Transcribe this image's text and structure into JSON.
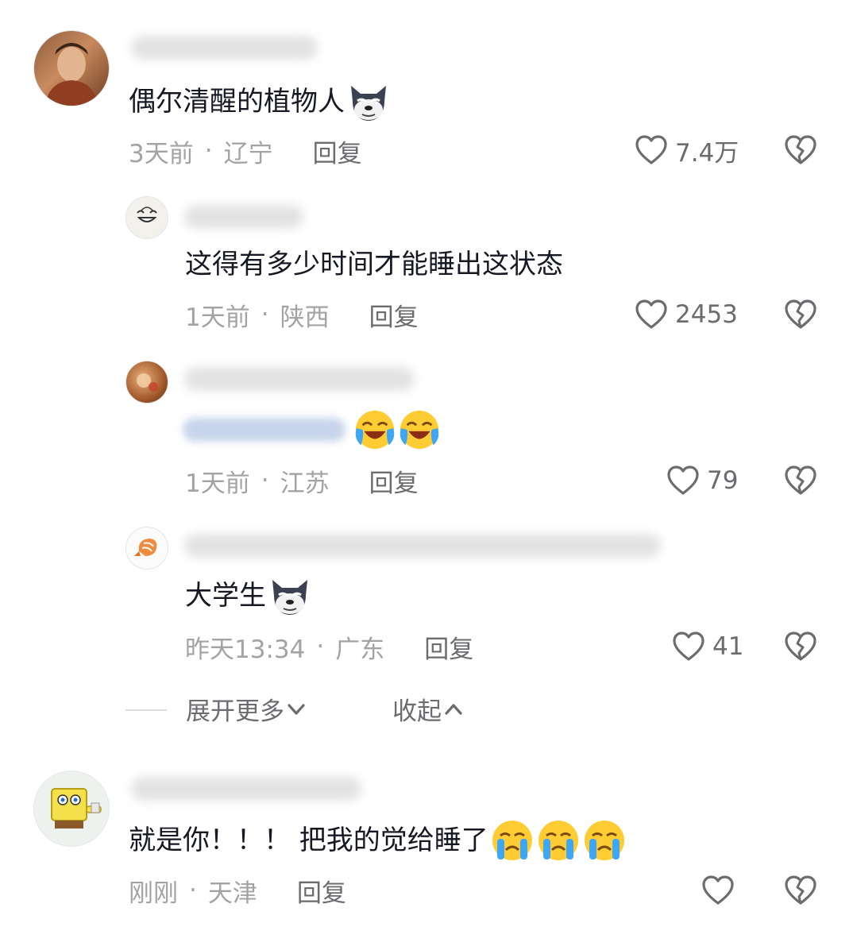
{
  "comments": [
    {
      "text": "偶尔清醒的植物人",
      "time": "3天前",
      "location": "辽宁",
      "reply_label": "回复",
      "likes": "7.4万",
      "avatar_icon": "person-photo-avatar",
      "emoji": [
        "wolf-face-emoji"
      ]
    },
    {
      "text": "这得有多少时间才能睡出这状态",
      "time": "1天前",
      "location": "陕西",
      "reply_label": "回复",
      "likes": "2453",
      "avatar_icon": "cartoon-face-avatar"
    },
    {
      "text": "",
      "time": "1天前",
      "location": "江苏",
      "reply_label": "回复",
      "likes": "79",
      "avatar_icon": "food-photo-avatar",
      "emoji": [
        "laughing-crying-emoji",
        "laughing-crying-emoji"
      ]
    },
    {
      "text": "大学生",
      "time": "昨天13:34",
      "location": "广东",
      "reply_label": "回复",
      "likes": "41",
      "avatar_icon": "shrimp-avatar",
      "emoji": [
        "wolf-face-emoji"
      ]
    },
    {
      "text": "就是你！！！ 把我的觉给睡了",
      "time": "刚刚",
      "location": "天津",
      "reply_label": "回复",
      "likes": "",
      "avatar_icon": "spongebob-avatar",
      "emoji": [
        "crying-face-emoji",
        "crying-face-emoji",
        "crying-face-emoji"
      ]
    }
  ],
  "thread_controls": {
    "expand_label": "展开更多",
    "collapse_label": "收起"
  },
  "colors": {
    "text": "#161823",
    "meta": "#a3a3a6",
    "action": "#6b6b70"
  }
}
